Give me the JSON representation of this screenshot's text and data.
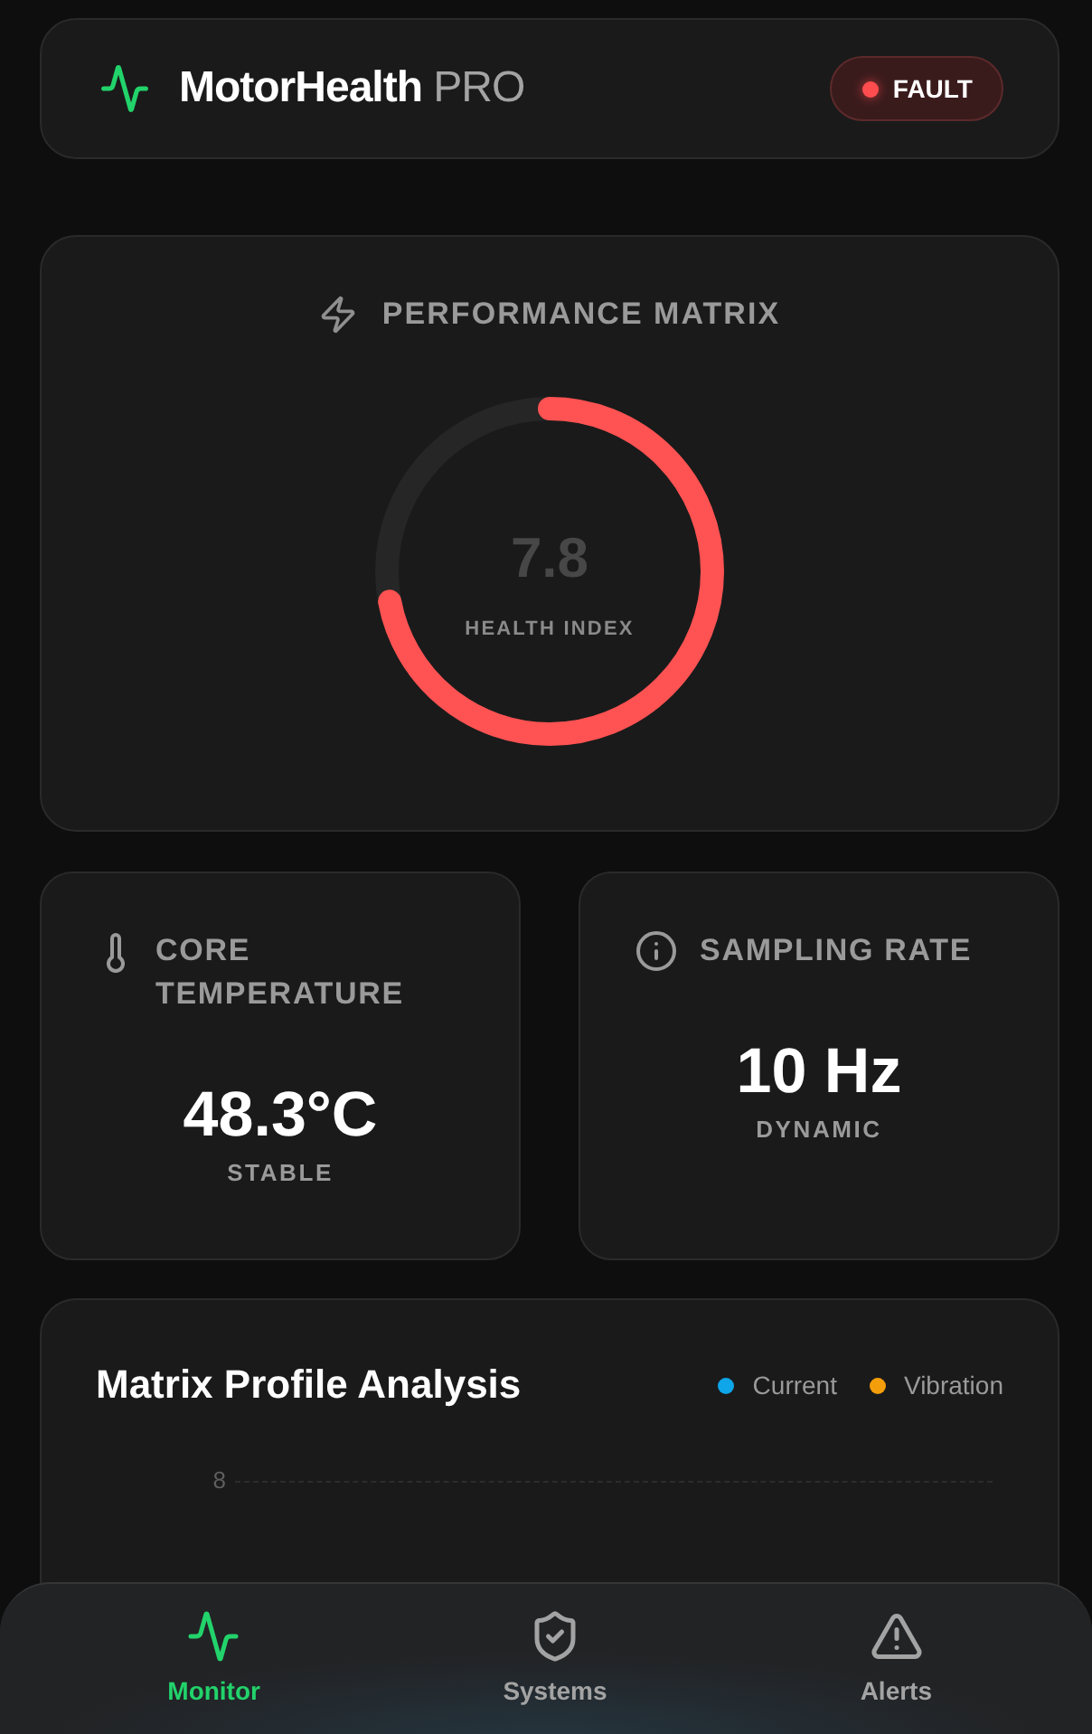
{
  "header": {
    "title": "MotorHealth",
    "title_suffix": "PRO",
    "status": {
      "label": "FAULT",
      "kind": "fault"
    }
  },
  "performance": {
    "title": "PERFORMANCE MATRIX",
    "gauge": {
      "value": "7.8",
      "label": "HEALTH INDEX",
      "level": 0.72
    }
  },
  "metrics": [
    {
      "kind": "temperature",
      "title": "CORE TEMPERATURE",
      "value": "48.3°C",
      "caption": "STABLE"
    },
    {
      "kind": "rate",
      "title": "SAMPLING RATE",
      "value": "10 Hz",
      "caption": "DYNAMIC"
    }
  ],
  "chart": {
    "title": "Matrix Profile Analysis",
    "legend": [
      {
        "label": "Current",
        "color": "#0ea5e9"
      },
      {
        "label": "Vibration",
        "color": "#f59e0b"
      }
    ],
    "y_tick_labels": [
      "8"
    ]
  },
  "bottom_nav": [
    {
      "label": "Monitor",
      "selected": true
    },
    {
      "label": "Systems",
      "selected": false
    },
    {
      "label": "Alerts",
      "selected": false
    }
  ]
}
